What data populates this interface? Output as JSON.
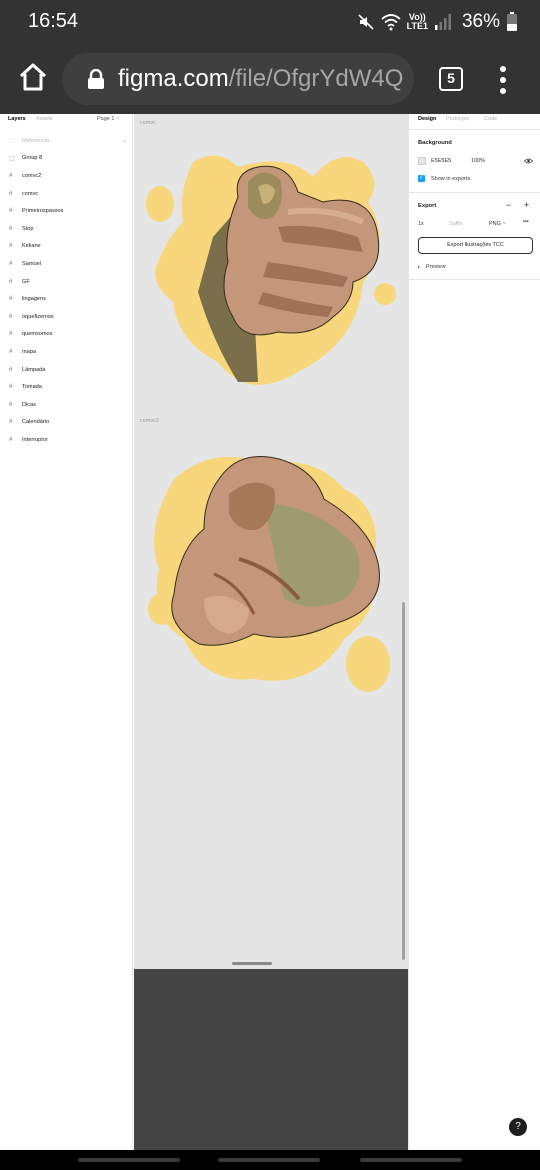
{
  "status_bar": {
    "time": "16:54",
    "network_top": "Vo))",
    "network_bottom": "LTE1",
    "battery_percent": "36%",
    "icons": [
      "mute-icon",
      "wifi-icon",
      "signal-icon",
      "battery-icon"
    ]
  },
  "browser": {
    "url_domain": "figma.com",
    "url_path": "/file/OfgrYdW4Q",
    "tab_count": "5"
  },
  "layers_panel": {
    "tabs": [
      "Layers",
      "Assets"
    ],
    "page_selector": "Page 1 ~",
    "items": [
      {
        "label": "Referencia",
        "icon": "frame-icon",
        "faded": true
      },
      {
        "label": "Group 8",
        "icon": "group-icon",
        "faded": false
      },
      {
        "label": "comvc2",
        "icon": "frame-icon",
        "faded": false
      },
      {
        "label": "comvc",
        "icon": "frame-icon",
        "faded": false
      },
      {
        "label": "Primeirospassos",
        "icon": "frame-icon",
        "faded": false
      },
      {
        "label": "Stop",
        "icon": "frame-icon",
        "faded": false
      },
      {
        "label": "Keliane",
        "icon": "frame-icon",
        "faded": false
      },
      {
        "label": "Samuel",
        "icon": "frame-icon",
        "faded": false
      },
      {
        "label": "GF",
        "icon": "frame-icon",
        "faded": false
      },
      {
        "label": "lingagens",
        "icon": "frame-icon",
        "faded": false
      },
      {
        "label": "oquefizemos",
        "icon": "frame-icon",
        "faded": false
      },
      {
        "label": "quemsomos",
        "icon": "frame-icon",
        "faded": false
      },
      {
        "label": "mapa",
        "icon": "frame-icon",
        "faded": false
      },
      {
        "label": "Lâmpada",
        "icon": "frame-icon",
        "faded": false
      },
      {
        "label": "Tomada",
        "icon": "frame-icon",
        "faded": false
      },
      {
        "label": "Dicas",
        "icon": "frame-icon",
        "faded": false
      },
      {
        "label": "Calendário",
        "icon": "frame-icon",
        "faded": false
      },
      {
        "label": "Interruptor",
        "icon": "frame-icon",
        "faded": false
      }
    ]
  },
  "canvas": {
    "background": "#E5E5E5",
    "frame1_label": "comvc",
    "frame2_label": "comvc2",
    "accent_yellow": "#F8D77C"
  },
  "design_panel": {
    "tabs": [
      "Design",
      "Prototype",
      "Code"
    ],
    "background_title": "Background",
    "bg_hex": "E5E5E5",
    "bg_opacity": "100%",
    "show_in_exports": "Show in exports",
    "export_title": "Export",
    "export_scale": "1x",
    "export_suffix_placeholder": "Suffix",
    "export_format": "PNG ~",
    "export_button": "Export Ilustrações TCC",
    "preview": "Preview"
  },
  "help": "?"
}
